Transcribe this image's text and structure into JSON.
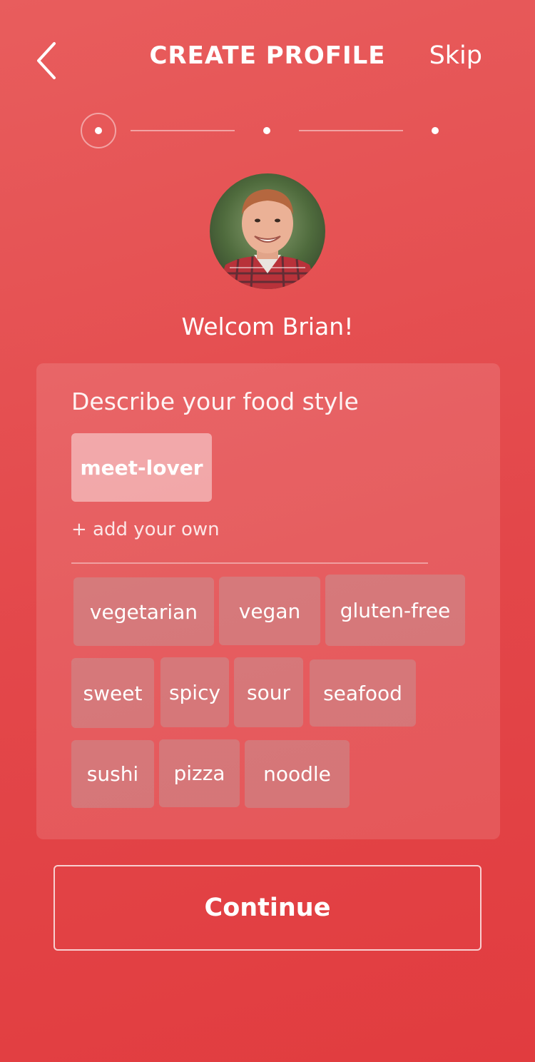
{
  "header": {
    "title": "CREATE PROFILE",
    "skip_label": "Skip"
  },
  "stepper": {
    "total_steps": 3,
    "current_step": 1
  },
  "profile": {
    "welcome_text": "Welcom Brian!"
  },
  "food_style": {
    "title": "Describe your food style",
    "selected_tags": [
      "meet-lover"
    ],
    "add_own_placeholder": "+ add your own",
    "suggestions": [
      "vegetarian",
      "vegan",
      "gluten-free",
      "sweet",
      "spicy",
      "sour",
      "seafood",
      "sushi",
      "pizza",
      "noodle"
    ]
  },
  "actions": {
    "continue_label": "Continue"
  },
  "colors": {
    "background": "#e34b4d",
    "text": "#ffffff"
  },
  "icons": {
    "back": "chevron-left-icon"
  }
}
